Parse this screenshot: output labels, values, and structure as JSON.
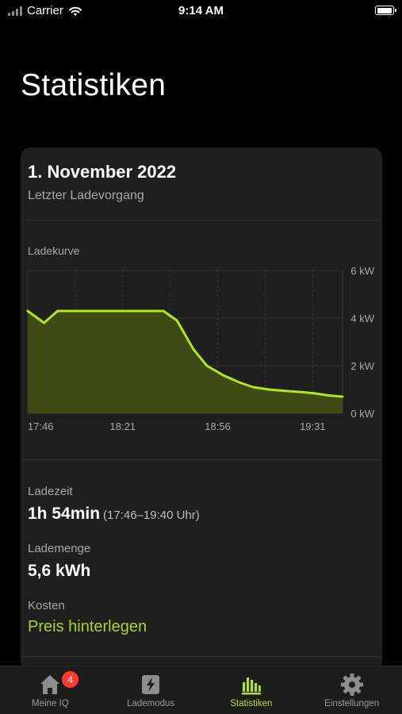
{
  "status_bar": {
    "carrier": "Carrier",
    "time": "9:14 AM",
    "battery_level": 1.0
  },
  "page_title": "Statistiken",
  "card": {
    "date": "1. November 2022",
    "subtitle": "Letzter Ladevorgang",
    "chart_section_label": "Ladekurve",
    "ladezeit": {
      "label": "Ladezeit",
      "value": "1h 54min",
      "range": "(17:46–19:40 Uhr)"
    },
    "lademenge": {
      "label": "Lademenge",
      "value": "5,6 kWh"
    },
    "kosten": {
      "label": "Kosten",
      "link": "Preis hinterlegen"
    }
  },
  "chart_data": {
    "type": "area",
    "title": "Ladekurve",
    "x_tick_labels": [
      "17:46",
      "18:21",
      "18:56",
      "19:31"
    ],
    "y_tick_labels": [
      "6 kW",
      "4 kW",
      "2 kW",
      "0 kW"
    ],
    "x_ticks_min": [
      0,
      35,
      70,
      105
    ],
    "ylim": [
      0,
      6
    ],
    "x_range_min": [
      0,
      116
    ],
    "series": [
      {
        "x_min": [
          0,
          6,
          11,
          17,
          28,
          39,
          50,
          55,
          61,
          66,
          72,
          78,
          83,
          89,
          94,
          100,
          105,
          111,
          116
        ],
        "y_kw": [
          4.3,
          3.8,
          4.3,
          4.3,
          4.3,
          4.3,
          4.3,
          3.9,
          2.7,
          2.0,
          1.6,
          1.3,
          1.1,
          1.0,
          0.95,
          0.9,
          0.85,
          0.75,
          0.7
        ]
      }
    ],
    "colors": {
      "line": "#b5e61d",
      "fill": "#3f4a14"
    },
    "grid": true
  },
  "tabs": [
    {
      "id": "home",
      "label": "Meine IQ",
      "icon": "home-icon",
      "badge": "4",
      "active": false
    },
    {
      "id": "lademodus",
      "label": "Lademodus",
      "icon": "bolt-icon",
      "active": false
    },
    {
      "id": "statistiken",
      "label": "Statistiken",
      "icon": "bar-chart-icon",
      "active": true
    },
    {
      "id": "einstellungen",
      "label": "Einstellungen",
      "icon": "gear-icon",
      "active": false
    }
  ]
}
